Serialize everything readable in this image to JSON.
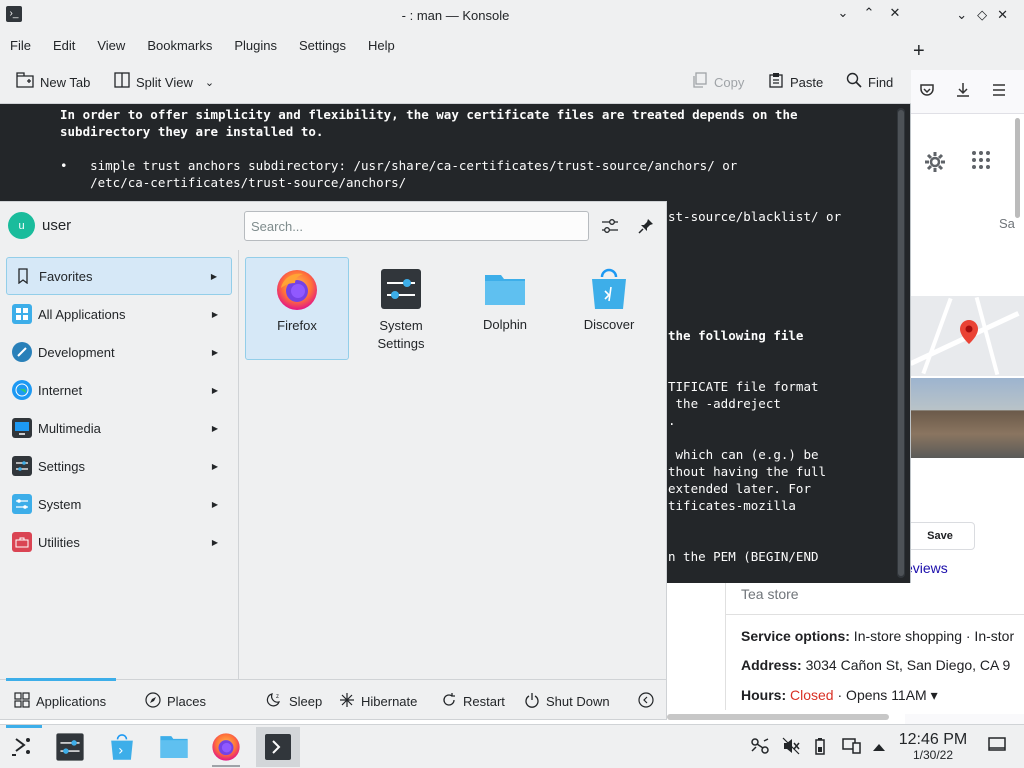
{
  "konsole": {
    "title": "- : man — Konsole",
    "menu": [
      "File",
      "Edit",
      "View",
      "Bookmarks",
      "Plugins",
      "Settings",
      "Help"
    ],
    "toolbar": {
      "new_tab": "New Tab",
      "split_view": "Split View",
      "copy": "Copy",
      "paste": "Paste",
      "find": "Find"
    },
    "terminal_lines": [
      "In order to offer simplicity and flexibility, the way certificate files are treated depends on the",
      "subdirectory they are installed to.",
      "",
      "•   simple trust anchors subdirectory: /usr/share/ca-certificates/trust-source/anchors/ or",
      "    /etc/ca-certificates/trust-source/anchors/",
      "",
      "st-source/blacklist/ or",
      "the following file",
      "TIFICATE file format",
      " the -addreject",
      ".",
      " which can (e.g.) be",
      "thout having the full",
      "extended later. For",
      "tificates-mozilla",
      "n the PEM (BEGIN/END"
    ]
  },
  "firefox": {
    "partial_label": "Sa",
    "save_button": "Save",
    "reviews_link": "eviews"
  },
  "business": {
    "type": "Tea store",
    "service_label": "Service options:",
    "service_value": " In-store shopping · In-stor",
    "address_label": "Address:",
    "address_value": " 3034 Cañon St, San Diego, CA 9",
    "hours_label": "Hours:",
    "hours_status": "Closed",
    "hours_next": " · Opens 11AM ▾"
  },
  "launcher": {
    "user_initial": "u",
    "user_name": "user",
    "search_placeholder": "Search...",
    "categories": [
      {
        "label": "Favorites",
        "icon_color": "#eff0f1"
      },
      {
        "label": "All Applications",
        "icon_color": "#3daee9"
      },
      {
        "label": "Development",
        "icon_color": "#2980b9"
      },
      {
        "label": "Internet",
        "icon_color": "#1d99f3"
      },
      {
        "label": "Multimedia",
        "icon_color": "#31363b"
      },
      {
        "label": "Settings",
        "icon_color": "#31363b"
      },
      {
        "label": "System",
        "icon_color": "#3daee9"
      },
      {
        "label": "Utilities",
        "icon_color": "#da4453"
      }
    ],
    "favorites": [
      {
        "label": "Firefox"
      },
      {
        "label": "System\nSettings"
      },
      {
        "label": "Dolphin"
      },
      {
        "label": "Discover"
      }
    ],
    "footer": {
      "applications": "Applications",
      "places": "Places",
      "sleep": "Sleep",
      "hibernate": "Hibernate",
      "restart": "Restart",
      "shutdown": "Shut Down"
    }
  },
  "taskbar": {
    "time": "12:46 PM",
    "date": "1/30/22"
  },
  "colors": {
    "accent": "#3daee9",
    "selection_bg": "#d6e8f7",
    "terminal_bg": "#232629",
    "closed_red": "#d93025",
    "link_blue": "#1a0dab"
  }
}
